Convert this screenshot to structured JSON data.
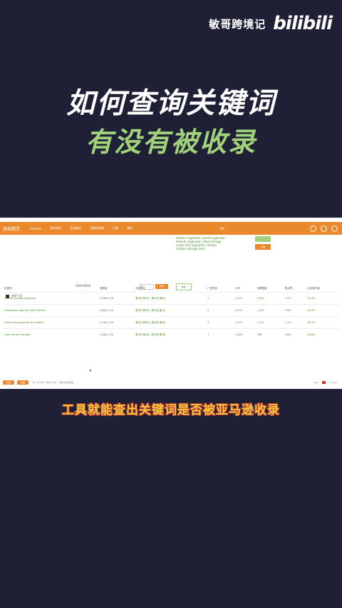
{
  "brand": {
    "channel": "敏哥跨境记",
    "platform": "bilibili"
  },
  "headline": {
    "line1": "如何查询关键词",
    "line2": "有没有被收录"
  },
  "screenshot": {
    "logo": "卖家精灵",
    "nav": [
      "Amazon",
      "查关键词",
      "选品精灵",
      "关键词挖掘",
      "反查",
      "插件"
    ],
    "user_label": "VIP",
    "keywords_text": [
      "clothes organizer, closet organizer",
      "dresser organizer, shoe storage",
      "under bed organizer, drawer",
      "clothes storage bins"
    ],
    "green_btn": "",
    "orange_btn": "查询",
    "query_label": "ASIN B0XX",
    "select_value": "US",
    "query_btn": "查询",
    "reset_btn": "重置",
    "count_label": "共4个词",
    "columns": [
      "关键词",
      "搜索量",
      "自然排名",
      "广告排名",
      "SPR",
      "标题密度",
      "购买率",
      "点击集中度",
      "操作"
    ],
    "rows": [
      [
        "clothes storage organizer",
        "3,456 | 1/4",
        "第1页 第3位 | 第1页 第8位",
        "1",
        "5,212",
        "3,500",
        "1.2%",
        "52.4%"
      ],
      [
        "collapsible organizer with handle",
        "2,820 | 1/4",
        "第1页 第5位 | 第2页 第1位",
        "2",
        "4,123",
        "1,345",
        "0.9%",
        "41.2%"
      ],
      [
        "under bed organizer for clothes",
        "2,104 | 1/4",
        "第1页 第9位 | 第2页 第6位",
        "3",
        "3,210",
        "1,120",
        "1.1%",
        "38.7%"
      ],
      [
        "cloth drawer storage",
        "1,580 | 1/4",
        "第2页 第2位 | 第3页 第4位",
        "1",
        "2,016",
        "968",
        "0.8%",
        "30.6%"
      ]
    ],
    "bottom_btn1": "导出",
    "bottom_btn2": "收藏",
    "bottom_note": "共 4 条记录，每页 20 条 · 关键词反查报告",
    "bottom_right": [
      "中文",
      "English"
    ]
  },
  "caption": "工具就能查出关键词是否被亚马逊收录",
  "colors": {
    "background": "#1f1f36",
    "orange": "#e9892c",
    "green": "#9fd27a",
    "caption": "#f2c93e"
  }
}
